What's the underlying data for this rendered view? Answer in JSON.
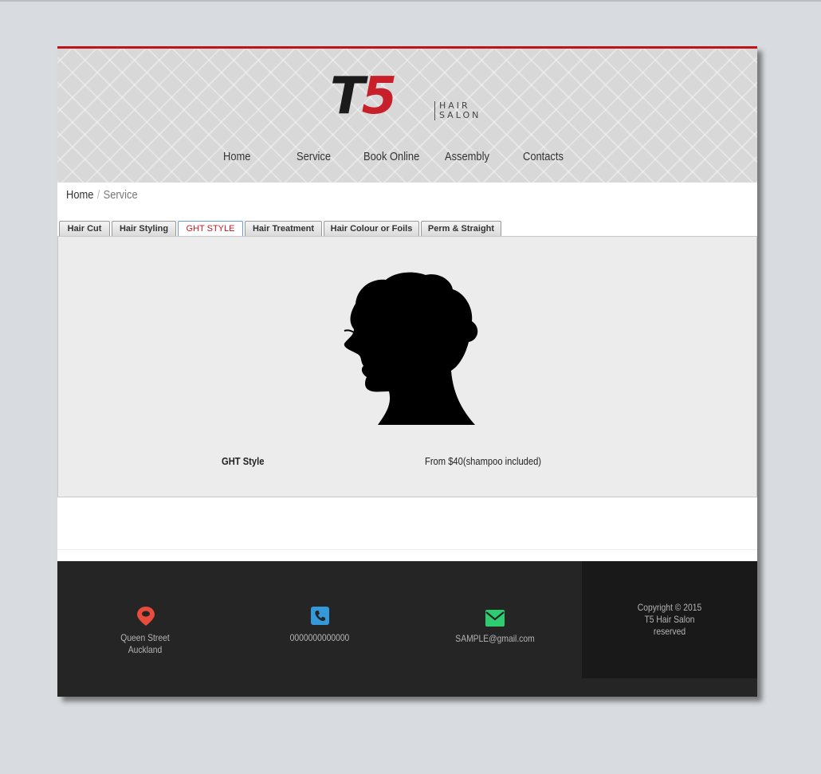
{
  "brand": {
    "logo_mark_t": "T",
    "logo_mark_5": "5",
    "logo_line1": "HAIR",
    "logo_line2": "SALON"
  },
  "nav": [
    {
      "label": "Home"
    },
    {
      "label": "Service"
    },
    {
      "label": "Book Online"
    },
    {
      "label": "Assembly"
    },
    {
      "label": "Contacts"
    }
  ],
  "breadcrumb": {
    "home": "Home",
    "separator": "/",
    "current": "Service"
  },
  "tabs": [
    {
      "label": "Hair Cut"
    },
    {
      "label": "Hair Styling"
    },
    {
      "label": "GHT STYLE",
      "active": true
    },
    {
      "label": "Hair Treatment"
    },
    {
      "label": "Hair Colour or Foils"
    },
    {
      "label": "Perm & Straight"
    }
  ],
  "service": {
    "name": "GHT Style",
    "price": "From $40(shampoo included)",
    "image_icon": "woman-silhouette"
  },
  "footer": {
    "address_line1": "Queen Street",
    "address_line2": "Auckland",
    "phone": "0000000000000",
    "email": "SAMPLE@gmail.com",
    "copyright_line1": "Copyright © 2015",
    "copyright_line2": "T5 Hair Salon",
    "copyright_line3": "reserved",
    "icons": {
      "location": "map-pin-icon",
      "phone": "phone-icon",
      "email": "envelope-icon"
    }
  },
  "colors": {
    "accent_red": "#c0141c",
    "tab_active_text": "#c41a22",
    "pin": "#e74c3c",
    "phone": "#3498db",
    "mail": "#2ecc71"
  }
}
